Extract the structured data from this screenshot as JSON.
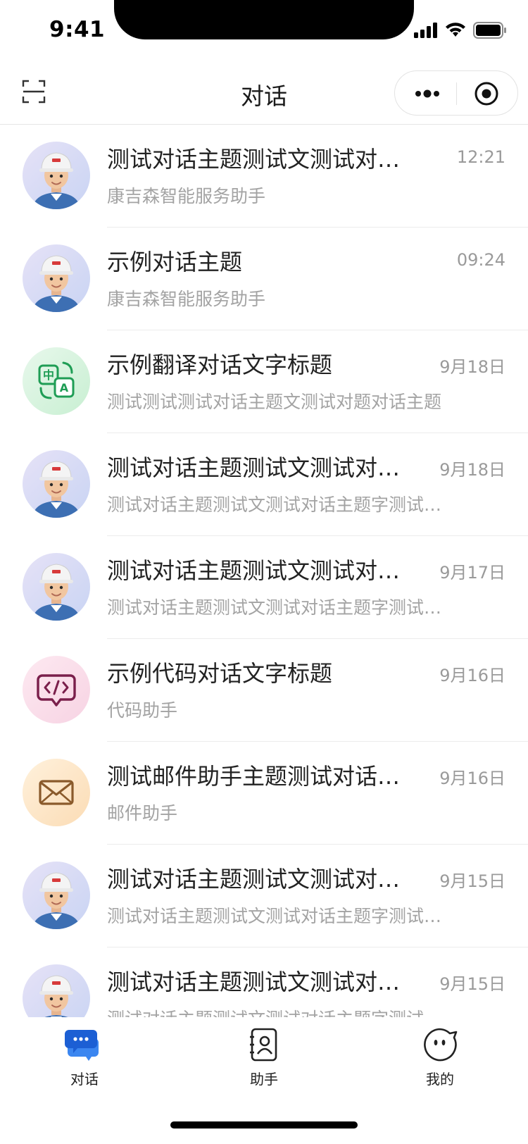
{
  "status_bar": {
    "time": "9:41"
  },
  "nav": {
    "title": "对话"
  },
  "conversations": [
    {
      "avatar": "worker-avatar",
      "title": "测试对话主题测试文测试对话主题",
      "subtitle": "康吉森智能服务助手",
      "time": "12:21"
    },
    {
      "avatar": "worker-avatar",
      "title": "示例对话主题",
      "subtitle": "康吉森智能服务助手",
      "time": "09:24"
    },
    {
      "avatar": "translate-icon",
      "title": "示例翻译对话文字标题",
      "subtitle": "测试测试测试对话主题文测试对题对话主题",
      "time": "9月18日"
    },
    {
      "avatar": "worker-avatar",
      "title": "测试对话主题测试文测试对话主题",
      "subtitle": "测试对话主题测试文测试对话主题字测试对话",
      "time": "9月18日"
    },
    {
      "avatar": "worker-avatar",
      "title": "测试对话主题测试文测试对话主题",
      "subtitle": "测试对话主题测试文测试对话主题字测试对话",
      "time": "9月17日"
    },
    {
      "avatar": "code-icon",
      "title": "示例代码对话文字标题",
      "subtitle": "代码助手",
      "time": "9月16日"
    },
    {
      "avatar": "mail-icon",
      "title": "测试邮件助手主题测试对话主题",
      "subtitle": "邮件助手",
      "time": "9月16日"
    },
    {
      "avatar": "worker-avatar",
      "title": "测试对话主题测试文测试对话主题",
      "subtitle": "测试对话主题测试文测试对话主题字测试对话",
      "time": "9月15日"
    },
    {
      "avatar": "worker-avatar",
      "title": "测试对话主题测试文测试对话主题",
      "subtitle": "测试对话主题测试文测试对话主题字测试对话",
      "time": "9月15日"
    }
  ],
  "tabs": [
    {
      "label": "对话",
      "icon": "chat-icon",
      "active": true
    },
    {
      "label": "助手",
      "icon": "contacts-icon",
      "active": false
    },
    {
      "label": "我的",
      "icon": "profile-face-icon",
      "active": false
    }
  ],
  "colors": {
    "accent": "#1f6fe5",
    "text": "#222222",
    "muted": "#a3a3a3"
  }
}
